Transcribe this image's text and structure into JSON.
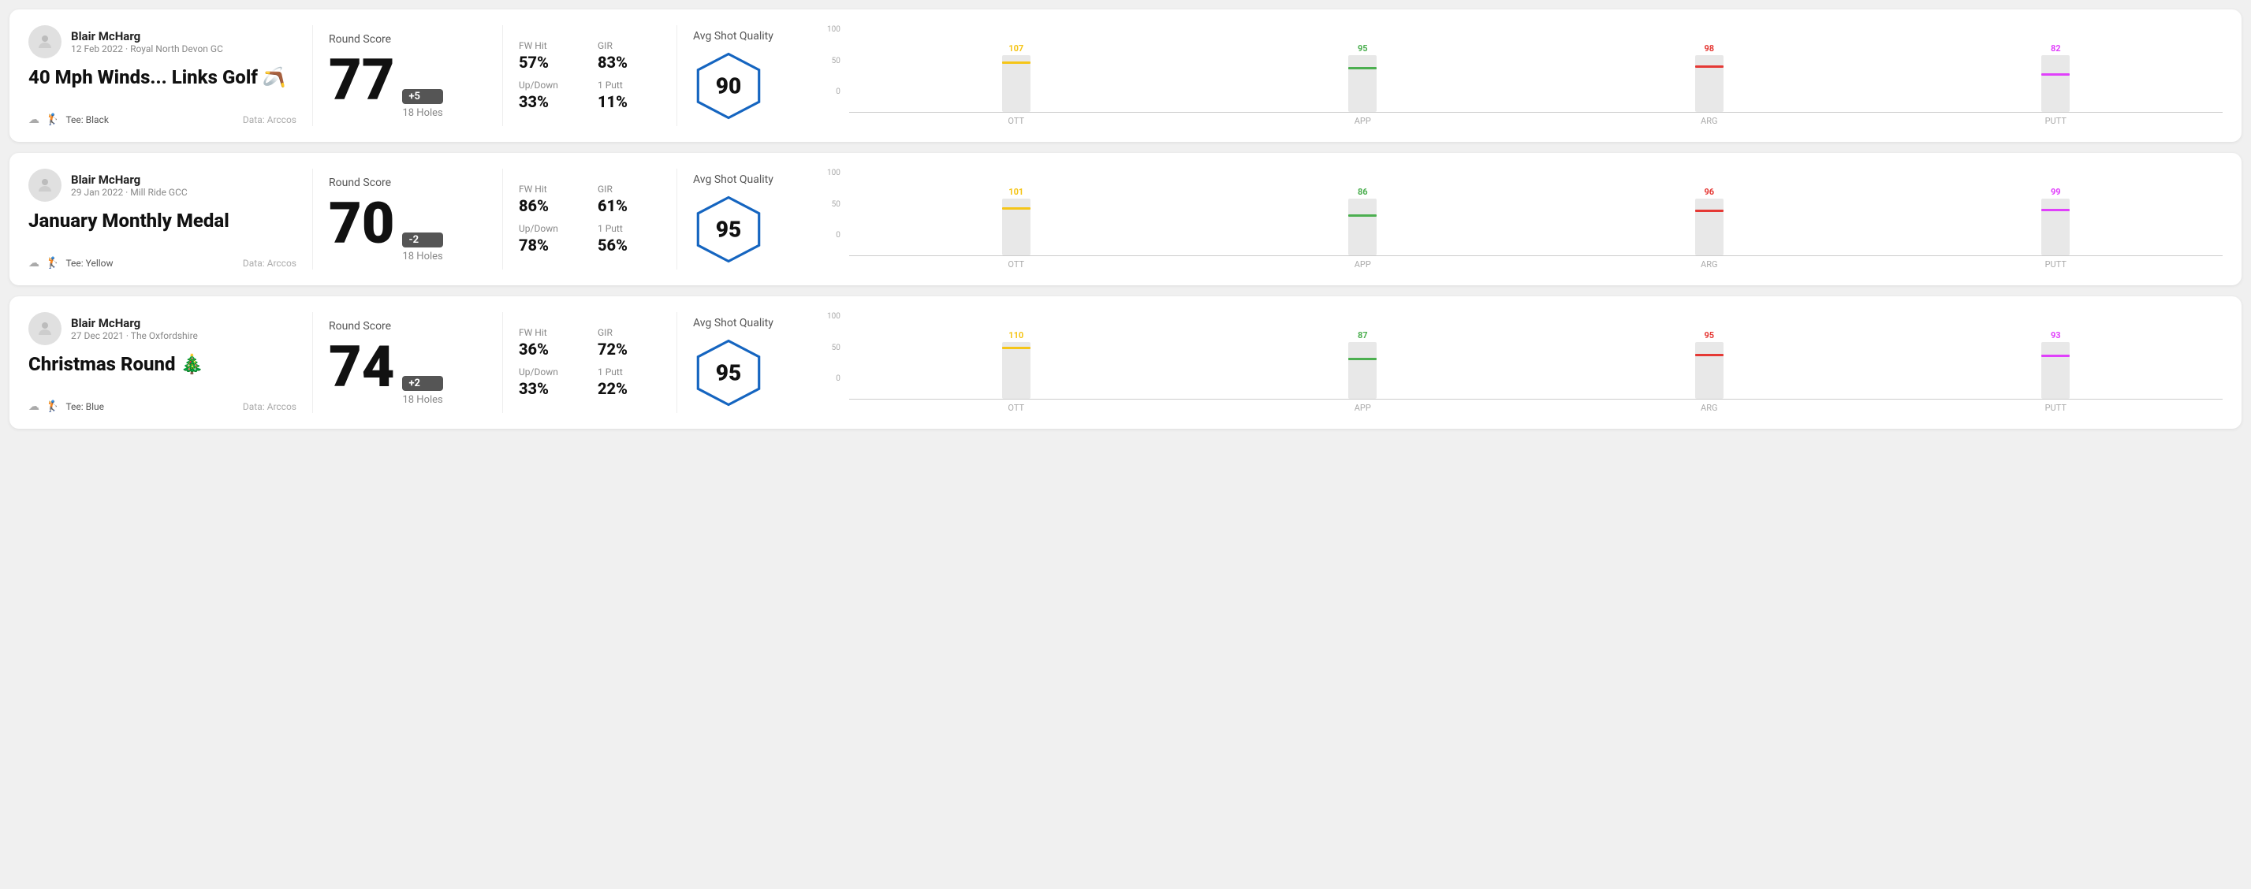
{
  "rounds": [
    {
      "id": "round1",
      "user": {
        "name": "Blair McHarg",
        "meta": "12 Feb 2022 · Royal North Devon GC"
      },
      "title": "40 Mph Winds... Links Golf 🪃",
      "tee": "Black",
      "data_source": "Data: Arccos",
      "score": {
        "label": "Round Score",
        "number": "77",
        "badge": "+5",
        "holes": "18 Holes"
      },
      "stats": {
        "fw_hit_label": "FW Hit",
        "fw_hit_value": "57%",
        "gir_label": "GIR",
        "gir_value": "83%",
        "updown_label": "Up/Down",
        "updown_value": "33%",
        "oneputt_label": "1 Putt",
        "oneputt_value": "11%"
      },
      "quality": {
        "label": "Avg Shot Quality",
        "score": "90"
      },
      "chart": {
        "bars": [
          {
            "label": "OTT",
            "value": 107,
            "color": "#f5c518"
          },
          {
            "label": "APP",
            "value": 95,
            "color": "#4caf50"
          },
          {
            "label": "ARG",
            "value": 98,
            "color": "#e53935"
          },
          {
            "label": "PUTT",
            "value": 82,
            "color": "#e040fb"
          }
        ],
        "ymax": 100,
        "yticks": [
          "100",
          "50",
          "0"
        ]
      }
    },
    {
      "id": "round2",
      "user": {
        "name": "Blair McHarg",
        "meta": "29 Jan 2022 · Mill Ride GCC"
      },
      "title": "January Monthly Medal",
      "tee": "Yellow",
      "data_source": "Data: Arccos",
      "score": {
        "label": "Round Score",
        "number": "70",
        "badge": "-2",
        "holes": "18 Holes"
      },
      "stats": {
        "fw_hit_label": "FW Hit",
        "fw_hit_value": "86%",
        "gir_label": "GIR",
        "gir_value": "61%",
        "updown_label": "Up/Down",
        "updown_value": "78%",
        "oneputt_label": "1 Putt",
        "oneputt_value": "56%"
      },
      "quality": {
        "label": "Avg Shot Quality",
        "score": "95"
      },
      "chart": {
        "bars": [
          {
            "label": "OTT",
            "value": 101,
            "color": "#f5c518"
          },
          {
            "label": "APP",
            "value": 86,
            "color": "#4caf50"
          },
          {
            "label": "ARG",
            "value": 96,
            "color": "#e53935"
          },
          {
            "label": "PUTT",
            "value": 99,
            "color": "#e040fb"
          }
        ],
        "ymax": 100,
        "yticks": [
          "100",
          "50",
          "0"
        ]
      }
    },
    {
      "id": "round3",
      "user": {
        "name": "Blair McHarg",
        "meta": "27 Dec 2021 · The Oxfordshire"
      },
      "title": "Christmas Round 🎄",
      "tee": "Blue",
      "data_source": "Data: Arccos",
      "score": {
        "label": "Round Score",
        "number": "74",
        "badge": "+2",
        "holes": "18 Holes"
      },
      "stats": {
        "fw_hit_label": "FW Hit",
        "fw_hit_value": "36%",
        "gir_label": "GIR",
        "gir_value": "72%",
        "updown_label": "Up/Down",
        "updown_value": "33%",
        "oneputt_label": "1 Putt",
        "oneputt_value": "22%"
      },
      "quality": {
        "label": "Avg Shot Quality",
        "score": "95"
      },
      "chart": {
        "bars": [
          {
            "label": "OTT",
            "value": 110,
            "color": "#f5c518"
          },
          {
            "label": "APP",
            "value": 87,
            "color": "#4caf50"
          },
          {
            "label": "ARG",
            "value": 95,
            "color": "#e53935"
          },
          {
            "label": "PUTT",
            "value": 93,
            "color": "#e040fb"
          }
        ],
        "ymax": 100,
        "yticks": [
          "100",
          "50",
          "0"
        ]
      }
    }
  ]
}
